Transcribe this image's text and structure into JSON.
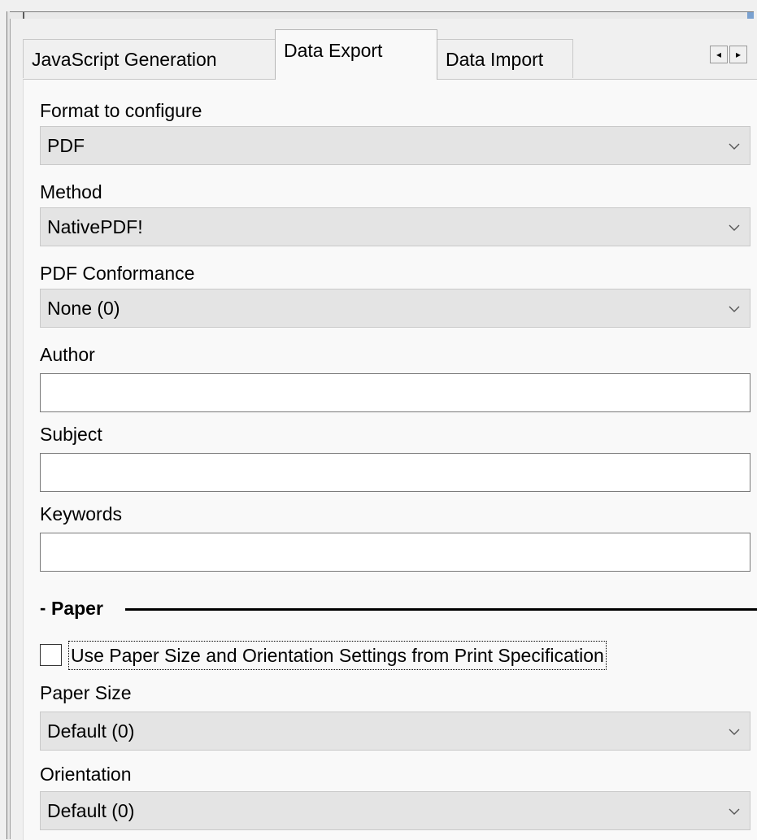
{
  "tabs": [
    {
      "label": "JavaScript Generation",
      "active": false
    },
    {
      "label": "Data Export",
      "active": true
    },
    {
      "label": "Data Import",
      "active": false
    }
  ],
  "tab_scroll": {
    "left_icon": "arrow-left-icon",
    "right_icon": "arrow-right-icon",
    "left_glyph": "◂",
    "right_glyph": "▸"
  },
  "fields": {
    "format_label": "Format to configure",
    "format_value": "PDF",
    "method_label": "Method",
    "method_value": "NativePDF!",
    "conformance_label": "PDF Conformance",
    "conformance_value": "None (0)",
    "author_label": "Author",
    "author_value": "",
    "subject_label": "Subject",
    "subject_value": "",
    "keywords_label": "Keywords",
    "keywords_value": ""
  },
  "paper": {
    "group_dash": "-",
    "group_title": "Paper",
    "use_print_spec_label": "Use Paper Size and Orientation Settings from Print Specification",
    "use_print_spec_checked": false,
    "paper_size_label": "Paper Size",
    "paper_size_value": "Default (0)",
    "orientation_label": "Orientation",
    "orientation_value": "Default (0)"
  },
  "colors": {
    "panel_bg": "#f9f9f9",
    "combo_bg": "#e4e4e4",
    "window_bg": "#f0f0f0"
  }
}
